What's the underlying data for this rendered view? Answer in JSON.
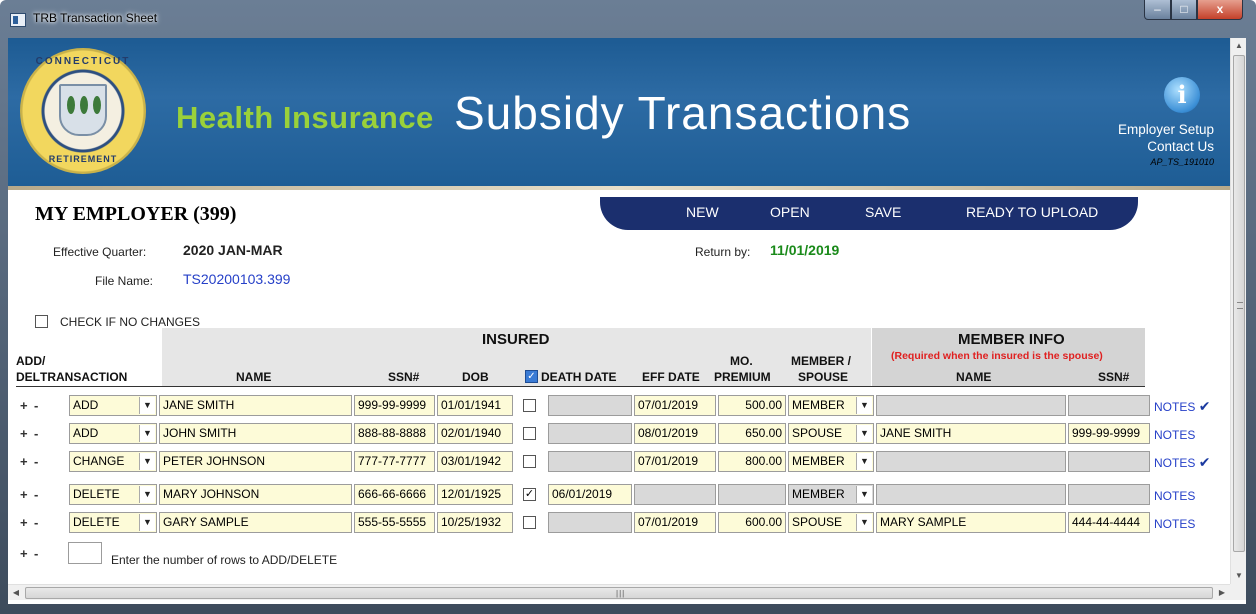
{
  "window": {
    "title": "TRB Transaction Sheet",
    "controls": {
      "minimize": "–",
      "maximize": "□",
      "close": "x"
    }
  },
  "banner": {
    "seal_text_top": "CONNECTICUT",
    "seal_text_bottom": "RETIREMENT",
    "title_part1": "Health Insurance",
    "title_part2": "Subsidy Transactions",
    "info_icon": "i",
    "employer_setup": "Employer Setup",
    "contact_us": "Contact Us",
    "version": "AP_TS_191010"
  },
  "employer": {
    "name": "MY EMPLOYER (399)"
  },
  "toolbar": {
    "new": "NEW",
    "open": "OPEN",
    "save": "SAVE",
    "ready": "READY TO UPLOAD"
  },
  "meta": {
    "effective_quarter_label": "Effective Quarter:",
    "effective_quarter": "2020 JAN-MAR",
    "file_name_label": "File Name:",
    "file_name": "TS20200103.399",
    "return_by_label": "Return by:",
    "return_by": "11/01/2019",
    "no_changes_label": "CHECK IF NO CHANGES"
  },
  "headers": {
    "insured": "INSURED",
    "member_info": "MEMBER INFO",
    "member_info_note": "(Required when the insured is the spouse)",
    "add_del_1": "ADD/",
    "add_del_2": "DEL",
    "transaction": "TRANSACTION",
    "name": "NAME",
    "ssn": "SSN#",
    "dob": "DOB",
    "death_date": "DEATH DATE",
    "eff_date": "EFF DATE",
    "mo": "MO.",
    "premium": "PREMIUM",
    "member_slash": "MEMBER /",
    "spouse": "SPOUSE",
    "m_name": "NAME",
    "m_ssn": "SSN#"
  },
  "rows": [
    {
      "transaction": "ADD",
      "name": "JANE SMITH",
      "ssn": "999-99-9999",
      "dob": "01/01/1941",
      "deceased": false,
      "death_date": "",
      "eff_date": "07/01/2019",
      "premium": "500.00",
      "member_spouse": "MEMBER",
      "m_name": "",
      "m_ssn": "",
      "notes": "NOTES",
      "notes_mark": "✔"
    },
    {
      "transaction": "ADD",
      "name": "JOHN SMITH",
      "ssn": "888-88-8888",
      "dob": "02/01/1940",
      "deceased": false,
      "death_date": "",
      "eff_date": "08/01/2019",
      "premium": "650.00",
      "member_spouse": "SPOUSE",
      "m_name": "JANE SMITH",
      "m_ssn": "999-99-9999",
      "notes": "NOTES",
      "notes_mark": ""
    },
    {
      "transaction": "CHANGE",
      "name": "PETER JOHNSON",
      "ssn": "777-77-7777",
      "dob": "03/01/1942",
      "deceased": false,
      "death_date": "",
      "eff_date": "07/01/2019",
      "premium": "800.00",
      "member_spouse": "MEMBER",
      "m_name": "",
      "m_ssn": "",
      "notes": "NOTES",
      "notes_mark": "✔"
    },
    {
      "transaction": "DELETE",
      "name": "MARY JOHNSON",
      "ssn": "666-66-6666",
      "dob": "12/01/1925",
      "deceased": true,
      "death_date": "06/01/2019",
      "eff_date": "",
      "premium": "",
      "member_spouse": "MEMBER",
      "m_name": "",
      "m_ssn": "",
      "notes": "NOTES",
      "notes_mark": ""
    },
    {
      "transaction": "DELETE",
      "name": "GARY SAMPLE",
      "ssn": "555-55-5555",
      "dob": "10/25/1932",
      "deceased": false,
      "death_date": "",
      "eff_date": "07/01/2019",
      "premium": "600.00",
      "member_spouse": "SPOUSE",
      "m_name": "MARY SAMPLE",
      "m_ssn": "444-44-4444",
      "notes": "NOTES",
      "notes_mark": ""
    }
  ],
  "footer": {
    "plus": "+",
    "minus": "-",
    "hint": "Enter the number of rows to ADD/DELETE"
  }
}
